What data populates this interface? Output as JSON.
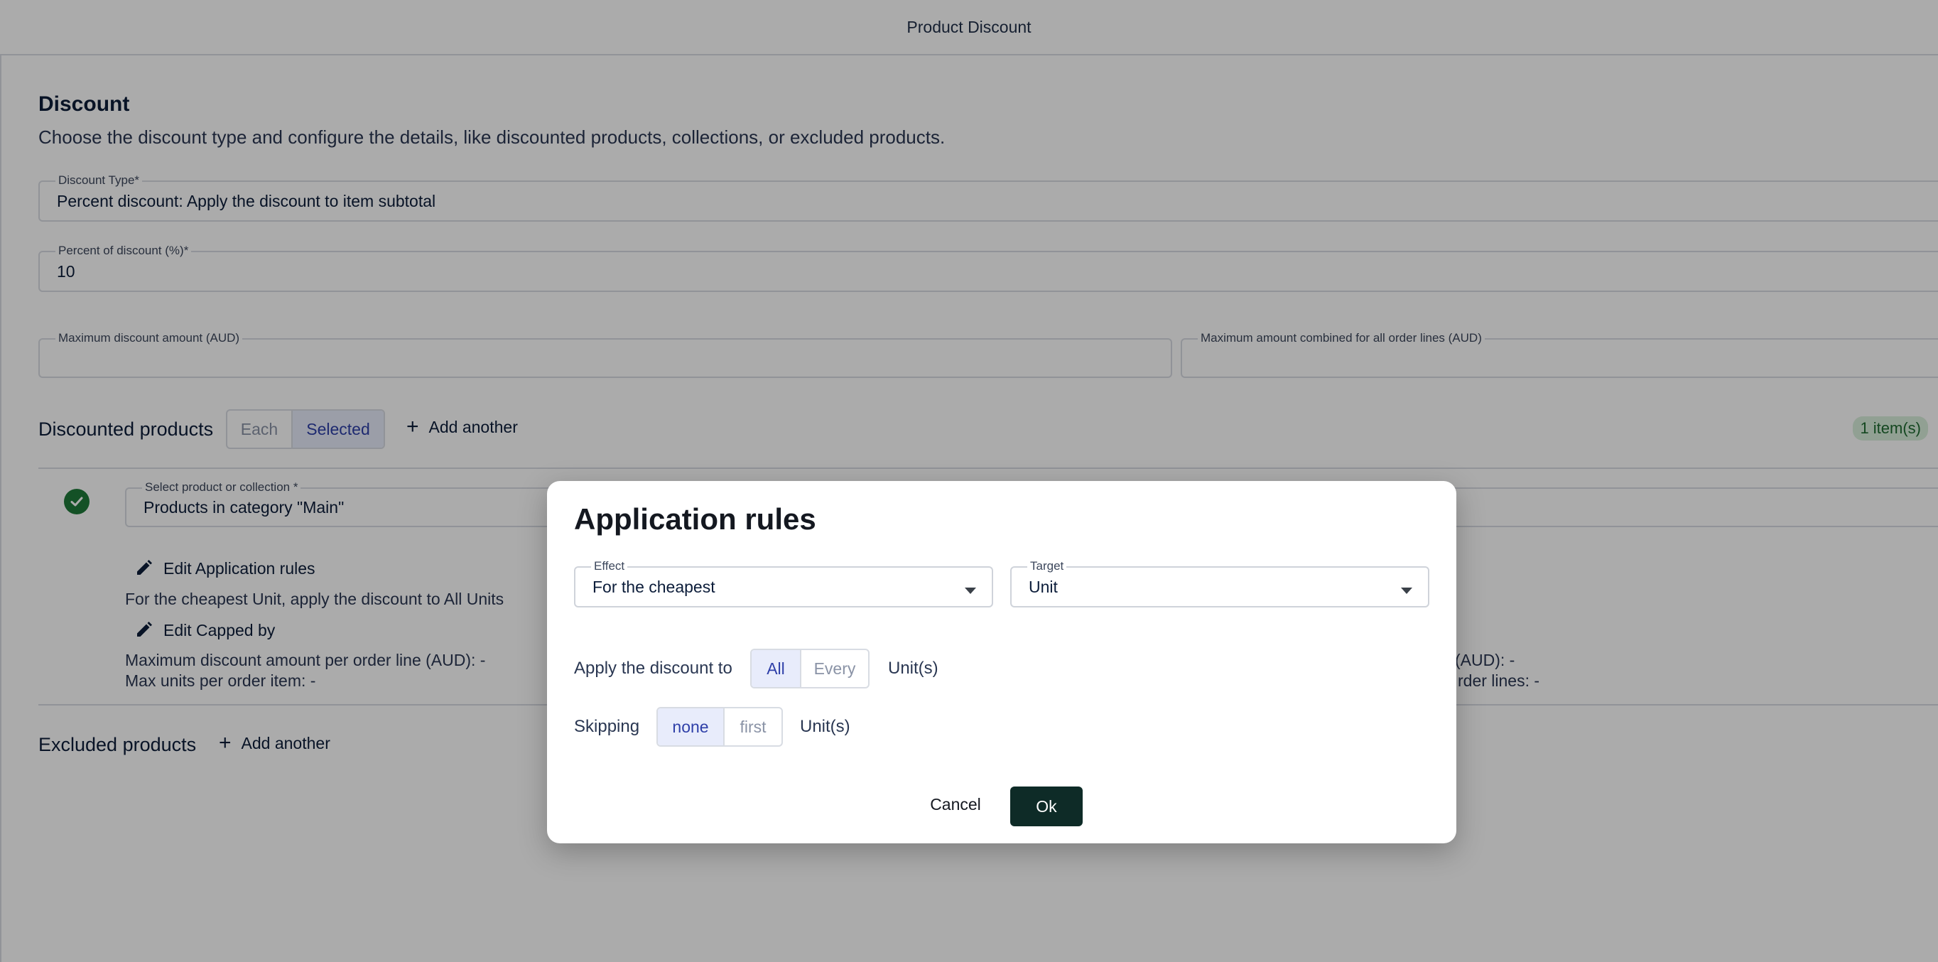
{
  "header": {
    "title": "Product Discount"
  },
  "discount": {
    "title": "Discount",
    "description": "Choose the discount type and configure the details, like discounted products, collections, or excluded products.",
    "type_label": "Discount Type*",
    "type_value": "Percent discount: Apply the discount to item subtotal",
    "percent_label": "Percent of discount (%)*",
    "percent_value": "10",
    "max_amount_label": "Maximum discount amount (AUD)",
    "max_combined_label": "Maximum amount combined for all order lines (AUD)"
  },
  "discounted_products": {
    "title": "Discounted products",
    "toggle": [
      "Each",
      "Selected"
    ],
    "active_toggle": "Selected",
    "add_label": "Add another",
    "badge": "1 item(s)",
    "select_label": "Select product or collection *",
    "select_value": "Products in category \"Main\"",
    "edit_rules_label": "Edit Application rules",
    "rules_summary": "For the cheapest Unit, apply the discount to All Units",
    "edit_capped_label": "Edit Capped by",
    "cap_line1": "Maximum discount amount per order line (AUD): -",
    "cap_line2": "Max units per order item: -",
    "cap_right1": "(AUD): -",
    "cap_right2": "rder lines: -"
  },
  "excluded_products": {
    "title": "Excluded products",
    "add_label": "Add another"
  },
  "modal": {
    "title": "Application rules",
    "effect_label": "Effect",
    "effect_value": "For the cheapest",
    "target_label": "Target",
    "target_value": "Unit",
    "apply_label": "Apply the discount to",
    "apply_options": [
      "All",
      "Every"
    ],
    "apply_active": "All",
    "apply_unit": "Unit(s)",
    "skip_label": "Skipping",
    "skip_options": [
      "none",
      "first"
    ],
    "skip_active": "none",
    "skip_unit": "Unit(s)",
    "cancel_label": "Cancel",
    "ok_label": "Ok"
  },
  "colors": {
    "primary_button": "#0e2b27",
    "toggle_active": "#2e3fa8",
    "success": "#1f7a3a"
  }
}
